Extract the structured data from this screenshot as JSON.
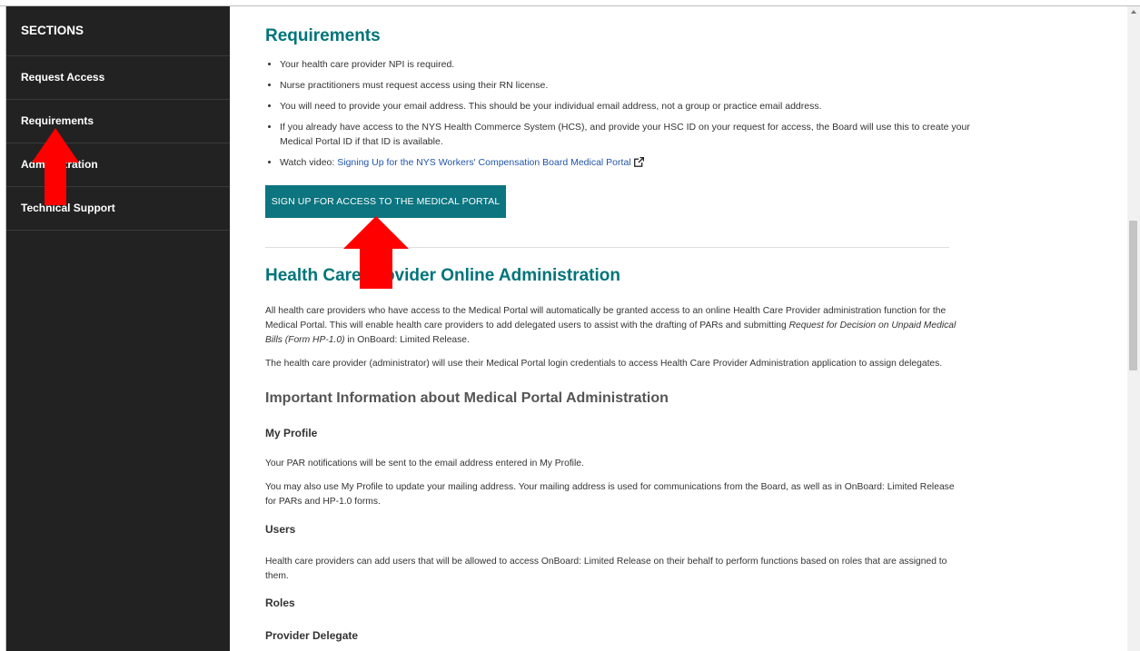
{
  "sidebar": {
    "heading": "SECTIONS",
    "items": [
      {
        "label": "Request Access"
      },
      {
        "label": "Requirements"
      },
      {
        "label": "Administration"
      },
      {
        "label": "Technical Support"
      }
    ]
  },
  "requirements": {
    "title": "Requirements",
    "items": [
      "Your health care provider NPI is required.",
      "Nurse practitioners must request access using their RN license.",
      "You will need to provide your email address. This should be your individual email address, not a group or practice email address.",
      "If you already have access to the NYS Health Commerce System (HCS), and provide your HSC ID on your request for access, the Board will use this to create your Medical Portal ID if that ID is available."
    ],
    "video_prefix": "Watch video: ",
    "video_link": "Signing Up for the NYS Workers' Compensation Board Medical Portal",
    "signup_button": "SIGN UP FOR ACCESS TO THE MEDICAL PORTAL"
  },
  "administration": {
    "title": "Health Care Provider Online Administration",
    "para1_a": "All health care providers who have access to the Medical Portal will automatically be granted access to an online Health Care Provider administration function for the Medical Portal. This will enable health care providers to add delegated users to assist with the drafting of PARs and submitting ",
    "para1_italic": "Request for Decision on Unpaid Medical Bills (Form HP-1.0)",
    "para1_b": " in OnBoard: Limited Release.",
    "para2": "The health care provider (administrator) will use their Medical Portal login credentials to access Health Care Provider Administration application to assign delegates.",
    "info_title": "Important Information about Medical Portal Administration",
    "my_profile_title": "My Profile",
    "my_profile_p1": "Your PAR notifications will be sent to the email address entered in My Profile.",
    "my_profile_p2": "You may also use My Profile to update your mailing address. Your mailing address is used for communications from the Board, as well as in OnBoard: Limited Release for PARs and HP-1.0 forms.",
    "users_title": "Users",
    "users_p": "Health care providers can add users that will be allowed to access OnBoard: Limited Release on their behalf to perform functions based on roles that are assigned to them.",
    "roles_title": "Roles",
    "provider_delegate_title": "Provider Delegate"
  },
  "colors": {
    "accent": "#00747a",
    "button": "#0c7580",
    "sidebar_bg": "#222222",
    "annotation_arrow": "#ff0000"
  }
}
